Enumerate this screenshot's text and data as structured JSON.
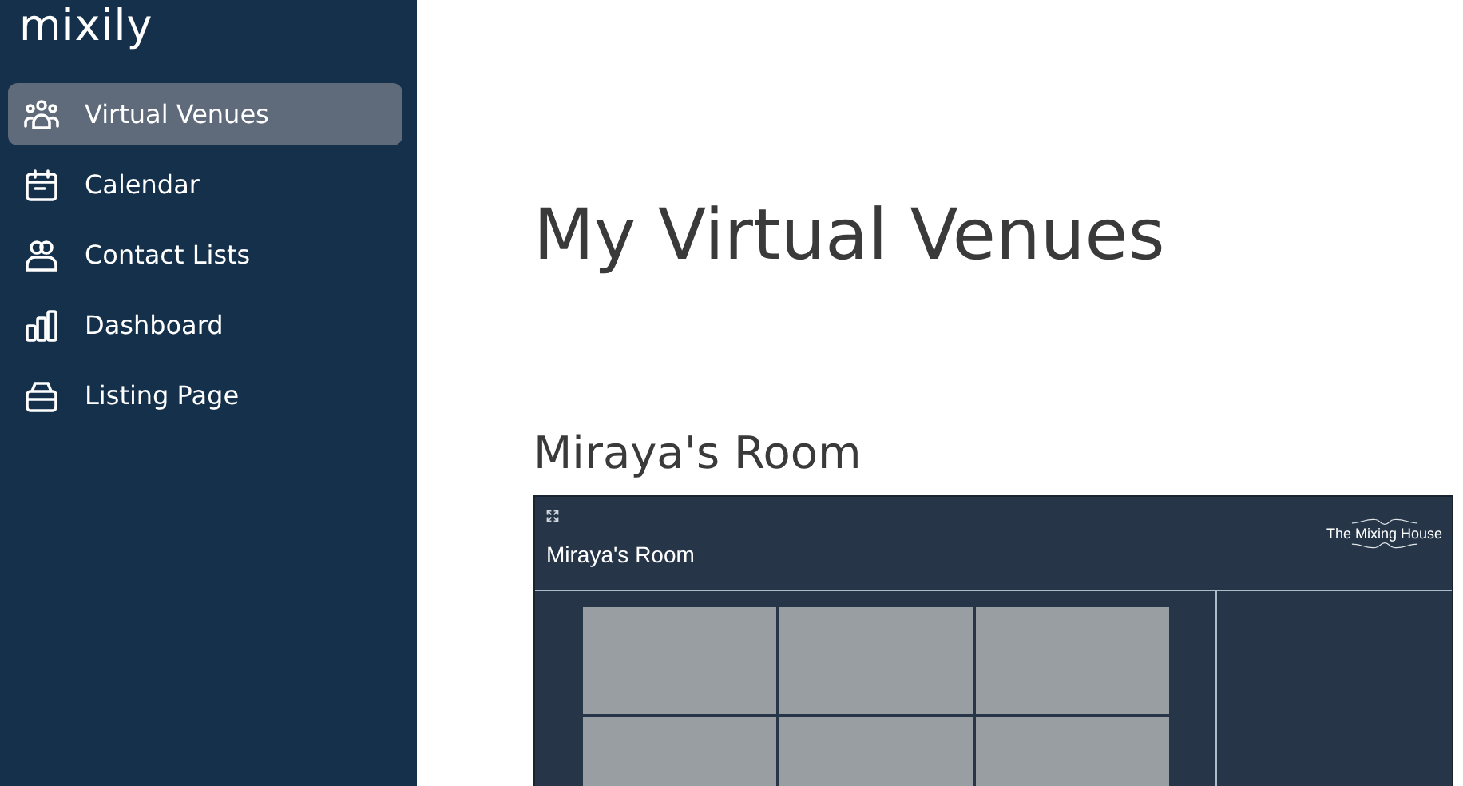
{
  "sidebar": {
    "logo": "mixily",
    "items": [
      {
        "label": "Virtual Venues",
        "selected": true
      },
      {
        "label": "Calendar",
        "selected": false
      },
      {
        "label": "Contact Lists",
        "selected": false
      },
      {
        "label": "Dashboard",
        "selected": false
      },
      {
        "label": "Listing Page",
        "selected": false
      }
    ]
  },
  "main": {
    "title": "My Virtual Venues",
    "venue": {
      "name": "Miraya's Room",
      "preview": {
        "title": "Miraya's Room",
        "brand": "The Mixing House"
      }
    }
  }
}
